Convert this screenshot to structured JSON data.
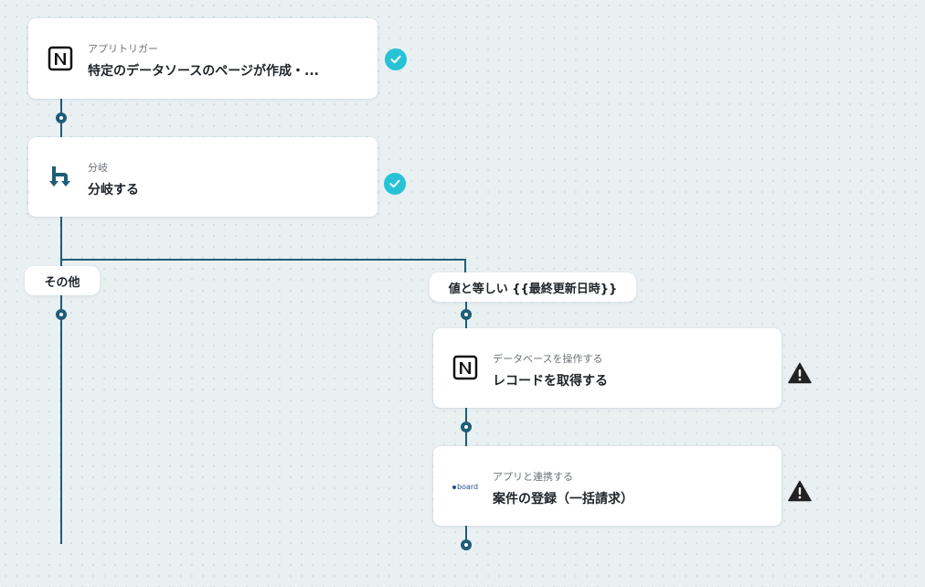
{
  "flow": {
    "trigger": {
      "subtitle": "アプリトリガー",
      "title": "特定のデータソースのページが作成・...",
      "app_icon": "notion-icon",
      "status": "completed"
    },
    "branch": {
      "subtitle": "分岐",
      "title": "分岐する",
      "app_icon": "branch-icon",
      "status": "completed"
    },
    "branch_labels": {
      "other": "その他",
      "condition": "値と等しい {{最終更新日時}}"
    },
    "step_notion": {
      "subtitle": "データベースを操作する",
      "title": "レコードを取得する",
      "app_icon": "notion-icon",
      "status": "warning"
    },
    "step_board": {
      "subtitle": "アプリと連携する",
      "title": "案件の登録（一括請求）",
      "app_icon": "board-logo-icon",
      "app_logo_text": "board",
      "status": "warning"
    }
  },
  "colors": {
    "connector": "#1f5d78",
    "check": "#27c2d6",
    "warning": "#222222",
    "background": "#e9f0f2"
  }
}
